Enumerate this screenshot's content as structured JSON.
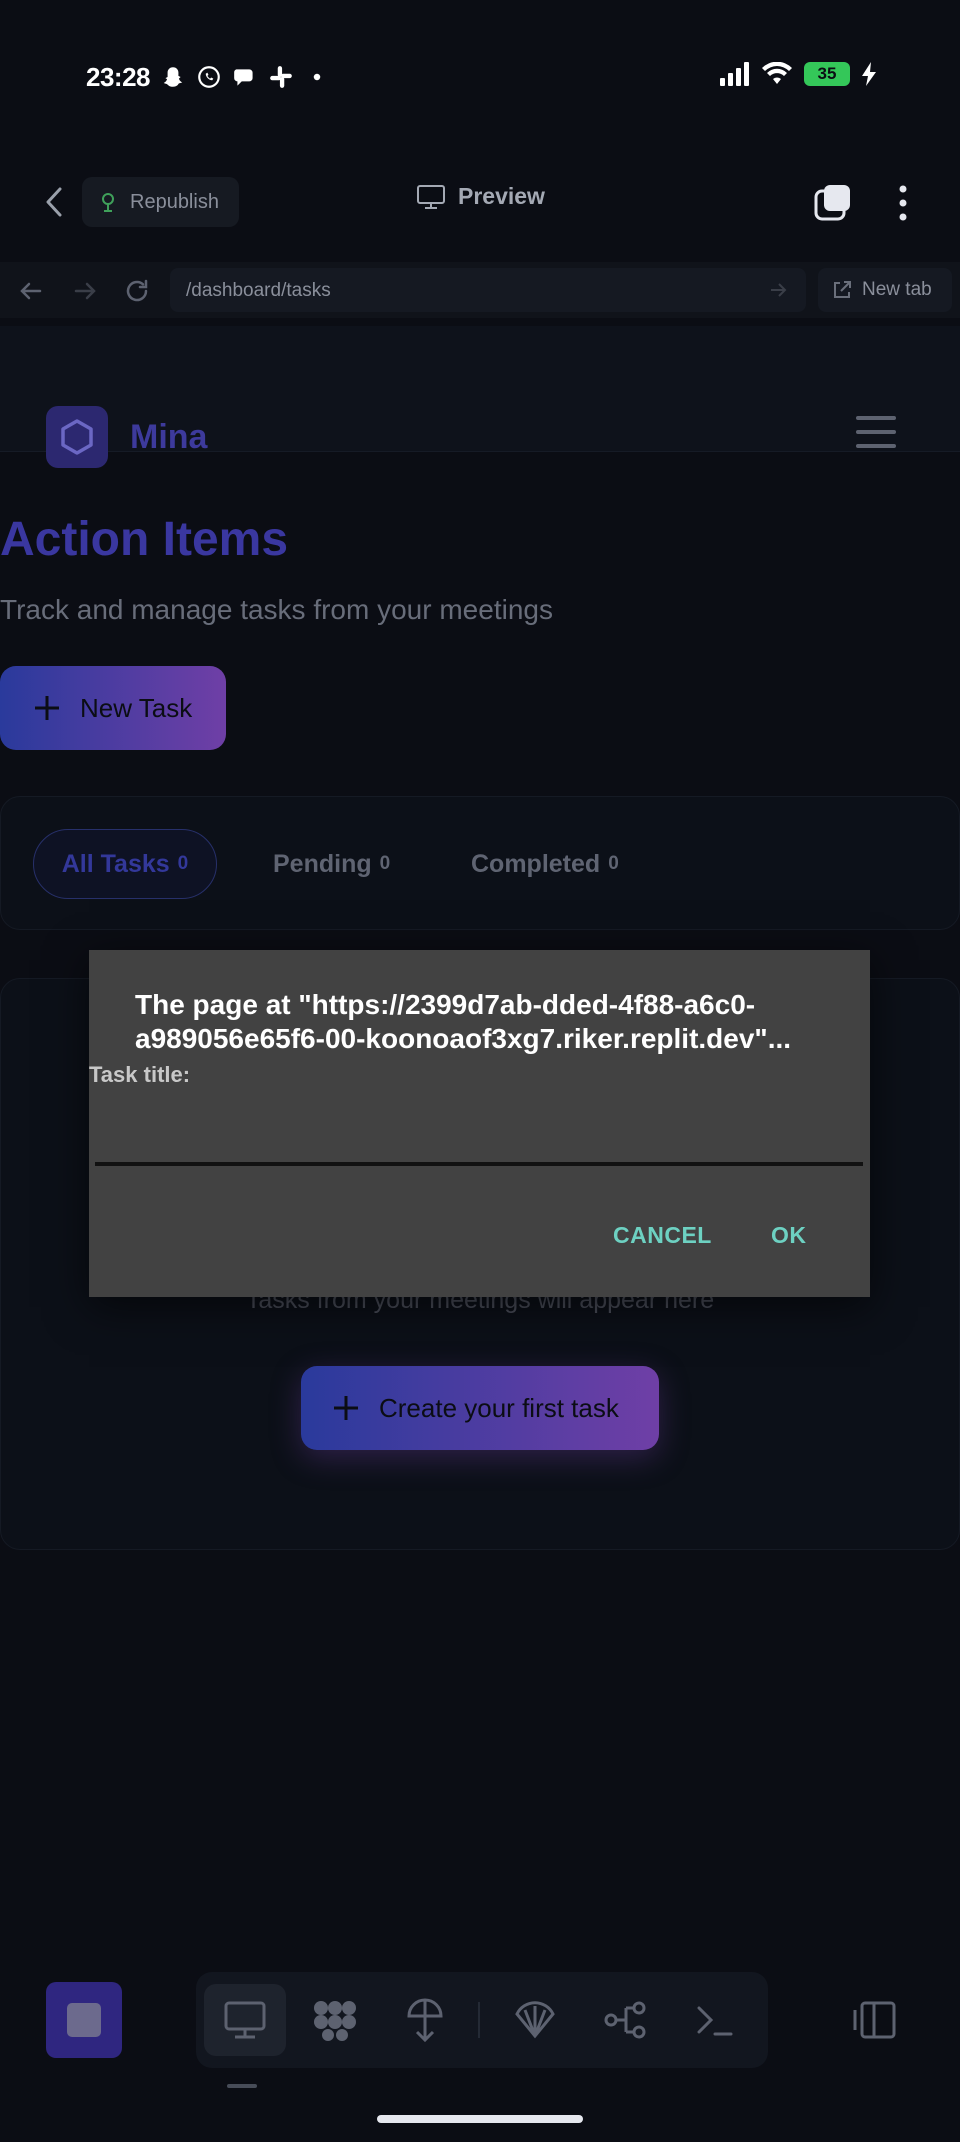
{
  "status": {
    "time": "23:28",
    "battery": "35"
  },
  "toolbar": {
    "republish_label": "Republish",
    "preview_label": "Preview"
  },
  "urlbar": {
    "path": "/dashboard/tasks",
    "new_tab_label": "New tab"
  },
  "app": {
    "brand": "Mina",
    "title": "Action Items",
    "subtitle": "Track and manage tasks from your meetings",
    "new_task_label": "New Task",
    "filters": [
      {
        "label": "All Tasks",
        "count": "0"
      },
      {
        "label": "Pending",
        "count": "0"
      },
      {
        "label": "Completed",
        "count": "0"
      }
    ],
    "empty_description": "Tasks from your meetings will appear here",
    "create_first_label": "Create your first task"
  },
  "dialog": {
    "title": "The page at \"https://2399d7ab-dded-4f88-a6c0-a989056e65f6-00-koonoaof3xg7.riker.replit.dev\"...",
    "label": "Task title:",
    "input_value": "",
    "cancel_label": "CANCEL",
    "ok_label": "OK"
  },
  "colors": {
    "accent_gradient_start": "#2a3a9c",
    "accent_gradient_end": "#6f3fa6",
    "dialog_bg": "#424242",
    "dialog_button": "#6dd1c2"
  }
}
